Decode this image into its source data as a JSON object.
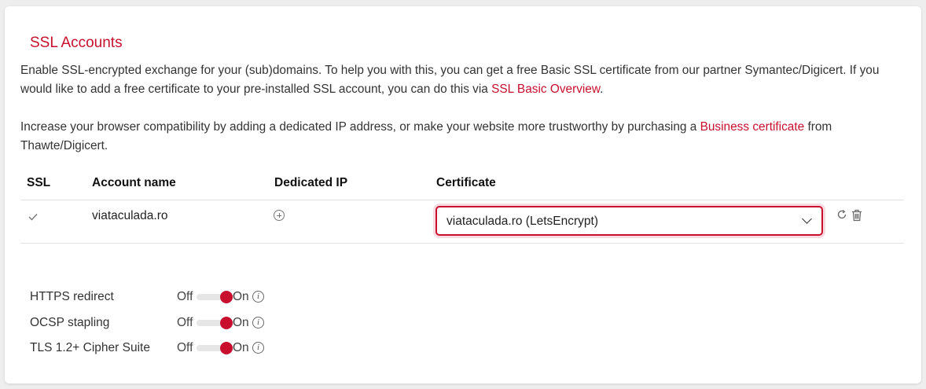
{
  "title": "SSL Accounts",
  "intro": {
    "p1_text": "Enable SSL-encrypted exchange for your (sub)domains. To help you with this, you can get a free Basic SSL certificate from our partner Symantec/Digicert. If you would like to add a free certificate to your pre-installed SSL account, you can do this via ",
    "p1_link": "SSL Basic Overview",
    "p1_end": ".",
    "p2_text": "Increase your browser compatibility by adding a dedicated IP address, or make your website more trustworthy by purchasing a ",
    "p2_link": "Business certificate",
    "p2_end": " from Thawte/Digicert."
  },
  "table": {
    "headers": [
      "SSL",
      "Account name",
      "Dedicated IP",
      "Certificate"
    ],
    "rows": [
      {
        "ssl_icon": "check-icon",
        "account": "viataculada.ro",
        "ip_icon": "plus-circle-icon",
        "certificate": "viataculada.ro (LetsEncrypt)"
      }
    ]
  },
  "options": [
    {
      "label": "HTTPS redirect",
      "off": "Off",
      "on": "On",
      "state": "on"
    },
    {
      "label": "OCSP stapling",
      "off": "Off",
      "on": "On",
      "state": "on"
    },
    {
      "label": "TLS 1.2+ Cipher Suite",
      "off": "Off",
      "on": "On",
      "state": "on"
    }
  ],
  "colors": {
    "accent": "#c8102e",
    "text": "#333333",
    "background": "#eeeeee"
  }
}
